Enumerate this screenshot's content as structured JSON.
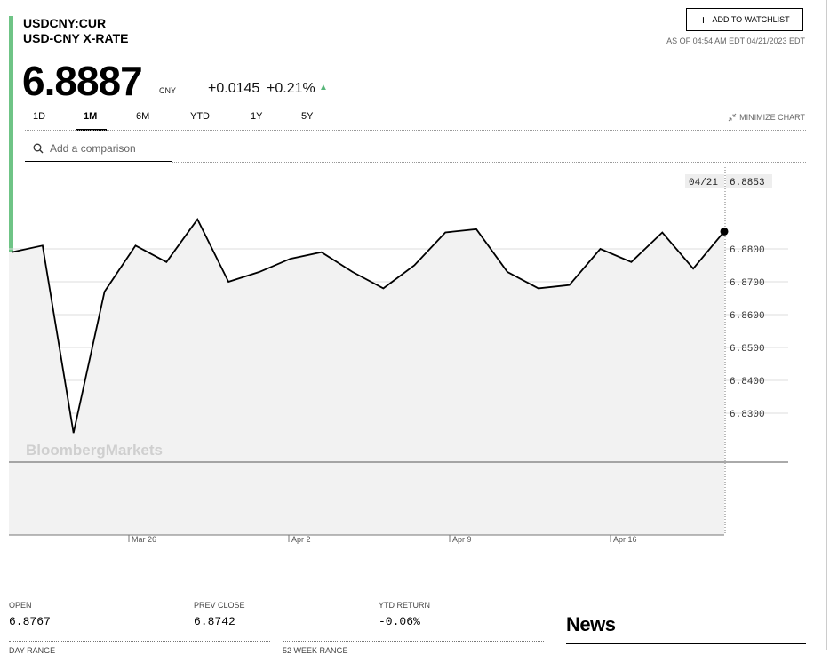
{
  "header": {
    "ticker": "USDCNY:CUR",
    "name": "USD-CNY X-RATE",
    "price": "6.8887",
    "currency": "CNY",
    "change": "+0.0145",
    "change_pct": "+0.21%",
    "direction_icon": "up-triangle-icon",
    "watchlist_label": "ADD TO WATCHLIST",
    "as_of": "AS OF 04:54 AM EDT 04/21/2023 EDT"
  },
  "tabs": [
    "1D",
    "1M",
    "6M",
    "YTD",
    "1Y",
    "5Y"
  ],
  "active_tab": "1M",
  "minimize_label": "MINIMIZE CHART",
  "search": {
    "placeholder": "Add a comparison"
  },
  "chart_data": {
    "type": "area",
    "series": [
      {
        "x": [
          "03/21",
          "03/22",
          "03/23",
          "03/24",
          "03/27",
          "03/28",
          "03/29",
          "03/30",
          "03/31",
          "04/03",
          "04/04",
          "04/05",
          "04/06",
          "04/07",
          "04/10",
          "04/11",
          "04/12",
          "04/13",
          "04/14",
          "04/17",
          "04/18",
          "04/19",
          "04/20",
          "04/21"
        ],
        "values": [
          6.879,
          6.881,
          6.824,
          6.867,
          6.881,
          6.876,
          6.889,
          6.87,
          6.873,
          6.877,
          6.879,
          6.873,
          6.868,
          6.875,
          6.885,
          6.886,
          6.873,
          6.868,
          6.869,
          6.88,
          6.876,
          6.885,
          6.874,
          6.8853
        ]
      }
    ],
    "yticks": [
      "6.8800",
      "6.8700",
      "6.8600",
      "6.8500",
      "6.8400",
      "6.8300"
    ],
    "xticks": [
      "Mar 26",
      "Apr 2",
      "Apr 9",
      "Apr 16"
    ],
    "tooltip": {
      "date": "04/21",
      "value": "6.8853"
    },
    "watermark": "BloombergMarkets",
    "colors": {
      "line": "#000000",
      "fill": "#f2f2f2",
      "grid": "#dddddd",
      "accent": "#6fc486"
    }
  },
  "stats": [
    {
      "label": "OPEN",
      "value": "6.8767"
    },
    {
      "label": "PREV CLOSE",
      "value": "6.8742"
    },
    {
      "label": "YTD RETURN",
      "value": "-0.06%"
    }
  ],
  "stats_row2": [
    "DAY RANGE",
    "52 WEEK RANGE"
  ],
  "news": {
    "title": "News"
  }
}
